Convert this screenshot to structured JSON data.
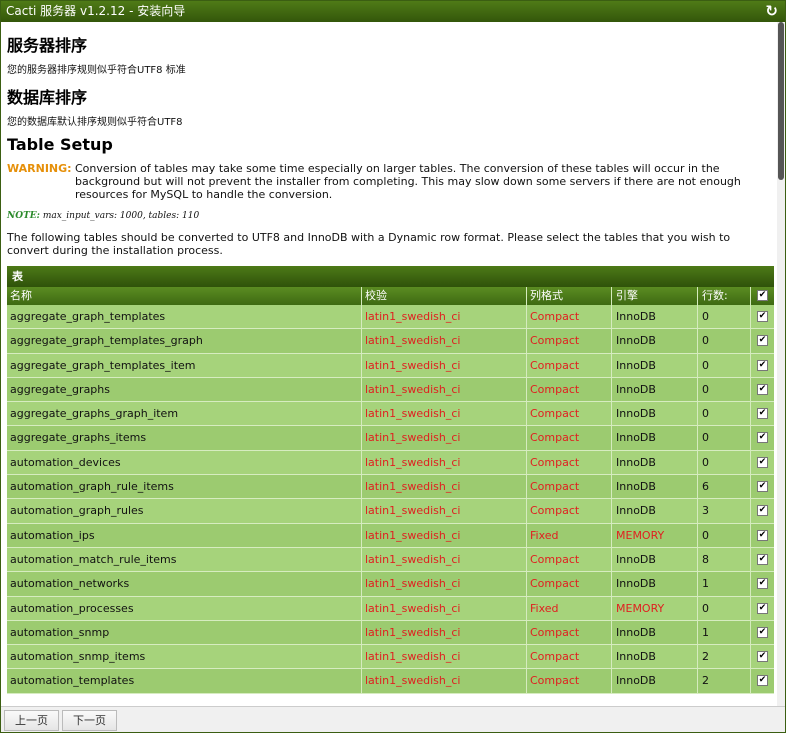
{
  "window": {
    "title": "Cacti 服务器 v1.2.12 - 安装向导",
    "refresh_icon": "refresh-icon"
  },
  "server_sort": {
    "heading": "服务器排序",
    "text": "您的服务器排序规则似乎符合UTF8 标准"
  },
  "db_sort": {
    "heading": "数据库排序",
    "text": "您的数据库默认排序规则似乎符合UTF8"
  },
  "table_setup": {
    "heading": "Table Setup",
    "warning_label": "WARNING:",
    "warning_text": "Conversion of tables may take some time especially on larger tables. The conversion of these tables will occur in the background but will not prevent the installer from completing. This may slow down some servers if there are not enough resources for MySQL to handle the conversion.",
    "note_label": "NOTE:",
    "note_text": "max_input_vars: 1000, tables: 110",
    "description": "The following tables should be converted to UTF8 and InnoDB with a Dynamic row format. Please select the tables that you wish to convert during the installation process."
  },
  "table": {
    "caption": "表",
    "headers": {
      "name": "名称",
      "collation": "校验",
      "row_format": "列格式",
      "engine": "引擎",
      "rows": "行数:"
    },
    "rows": [
      {
        "name": "aggregate_graph_templates",
        "collation": "latin1_swedish_ci",
        "row_format": "Compact",
        "engine": "InnoDB",
        "rows": "0",
        "engine_red": false
      },
      {
        "name": "aggregate_graph_templates_graph",
        "collation": "latin1_swedish_ci",
        "row_format": "Compact",
        "engine": "InnoDB",
        "rows": "0",
        "engine_red": false
      },
      {
        "name": "aggregate_graph_templates_item",
        "collation": "latin1_swedish_ci",
        "row_format": "Compact",
        "engine": "InnoDB",
        "rows": "0",
        "engine_red": false
      },
      {
        "name": "aggregate_graphs",
        "collation": "latin1_swedish_ci",
        "row_format": "Compact",
        "engine": "InnoDB",
        "rows": "0",
        "engine_red": false
      },
      {
        "name": "aggregate_graphs_graph_item",
        "collation": "latin1_swedish_ci",
        "row_format": "Compact",
        "engine": "InnoDB",
        "rows": "0",
        "engine_red": false
      },
      {
        "name": "aggregate_graphs_items",
        "collation": "latin1_swedish_ci",
        "row_format": "Compact",
        "engine": "InnoDB",
        "rows": "0",
        "engine_red": false
      },
      {
        "name": "automation_devices",
        "collation": "latin1_swedish_ci",
        "row_format": "Compact",
        "engine": "InnoDB",
        "rows": "0",
        "engine_red": false
      },
      {
        "name": "automation_graph_rule_items",
        "collation": "latin1_swedish_ci",
        "row_format": "Compact",
        "engine": "InnoDB",
        "rows": "6",
        "engine_red": false
      },
      {
        "name": "automation_graph_rules",
        "collation": "latin1_swedish_ci",
        "row_format": "Compact",
        "engine": "InnoDB",
        "rows": "3",
        "engine_red": false
      },
      {
        "name": "automation_ips",
        "collation": "latin1_swedish_ci",
        "row_format": "Fixed",
        "engine": "MEMORY",
        "rows": "0",
        "engine_red": true
      },
      {
        "name": "automation_match_rule_items",
        "collation": "latin1_swedish_ci",
        "row_format": "Compact",
        "engine": "InnoDB",
        "rows": "8",
        "engine_red": false
      },
      {
        "name": "automation_networks",
        "collation": "latin1_swedish_ci",
        "row_format": "Compact",
        "engine": "InnoDB",
        "rows": "1",
        "engine_red": false
      },
      {
        "name": "automation_processes",
        "collation": "latin1_swedish_ci",
        "row_format": "Fixed",
        "engine": "MEMORY",
        "rows": "0",
        "engine_red": true
      },
      {
        "name": "automation_snmp",
        "collation": "latin1_swedish_ci",
        "row_format": "Compact",
        "engine": "InnoDB",
        "rows": "1",
        "engine_red": false
      },
      {
        "name": "automation_snmp_items",
        "collation": "latin1_swedish_ci",
        "row_format": "Compact",
        "engine": "InnoDB",
        "rows": "2",
        "engine_red": false
      },
      {
        "name": "automation_templates",
        "collation": "latin1_swedish_ci",
        "row_format": "Compact",
        "engine": "InnoDB",
        "rows": "2",
        "engine_red": false
      }
    ]
  },
  "footer": {
    "prev_label": "上一页",
    "next_label": "下一页"
  }
}
